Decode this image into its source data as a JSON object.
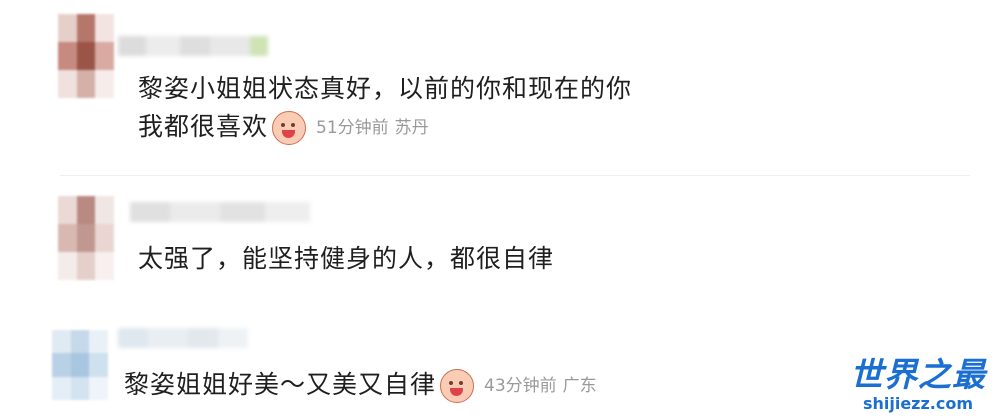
{
  "comments": [
    {
      "text_line1": "黎姿小姐姐状态真好，以前的你和现在的你",
      "text_line2": "我都很喜欢",
      "emoji": "laughing-emoji",
      "time": "51分钟前",
      "location": "苏丹"
    },
    {
      "text_line1": "太强了，能坚持健身的人，都很自律"
    },
    {
      "text_line1": "黎姿姐姐好美～又美又自律",
      "emoji": "laughing-emoji",
      "time": "43分钟前",
      "location": "广东"
    }
  ],
  "watermark": {
    "title": "世界之最",
    "url": "shijiezz.com",
    "color": "#1a6fd1"
  },
  "colors": {
    "text": "#1f1f1f",
    "meta": "#9a9a9a",
    "divider": "#eeeeee"
  }
}
